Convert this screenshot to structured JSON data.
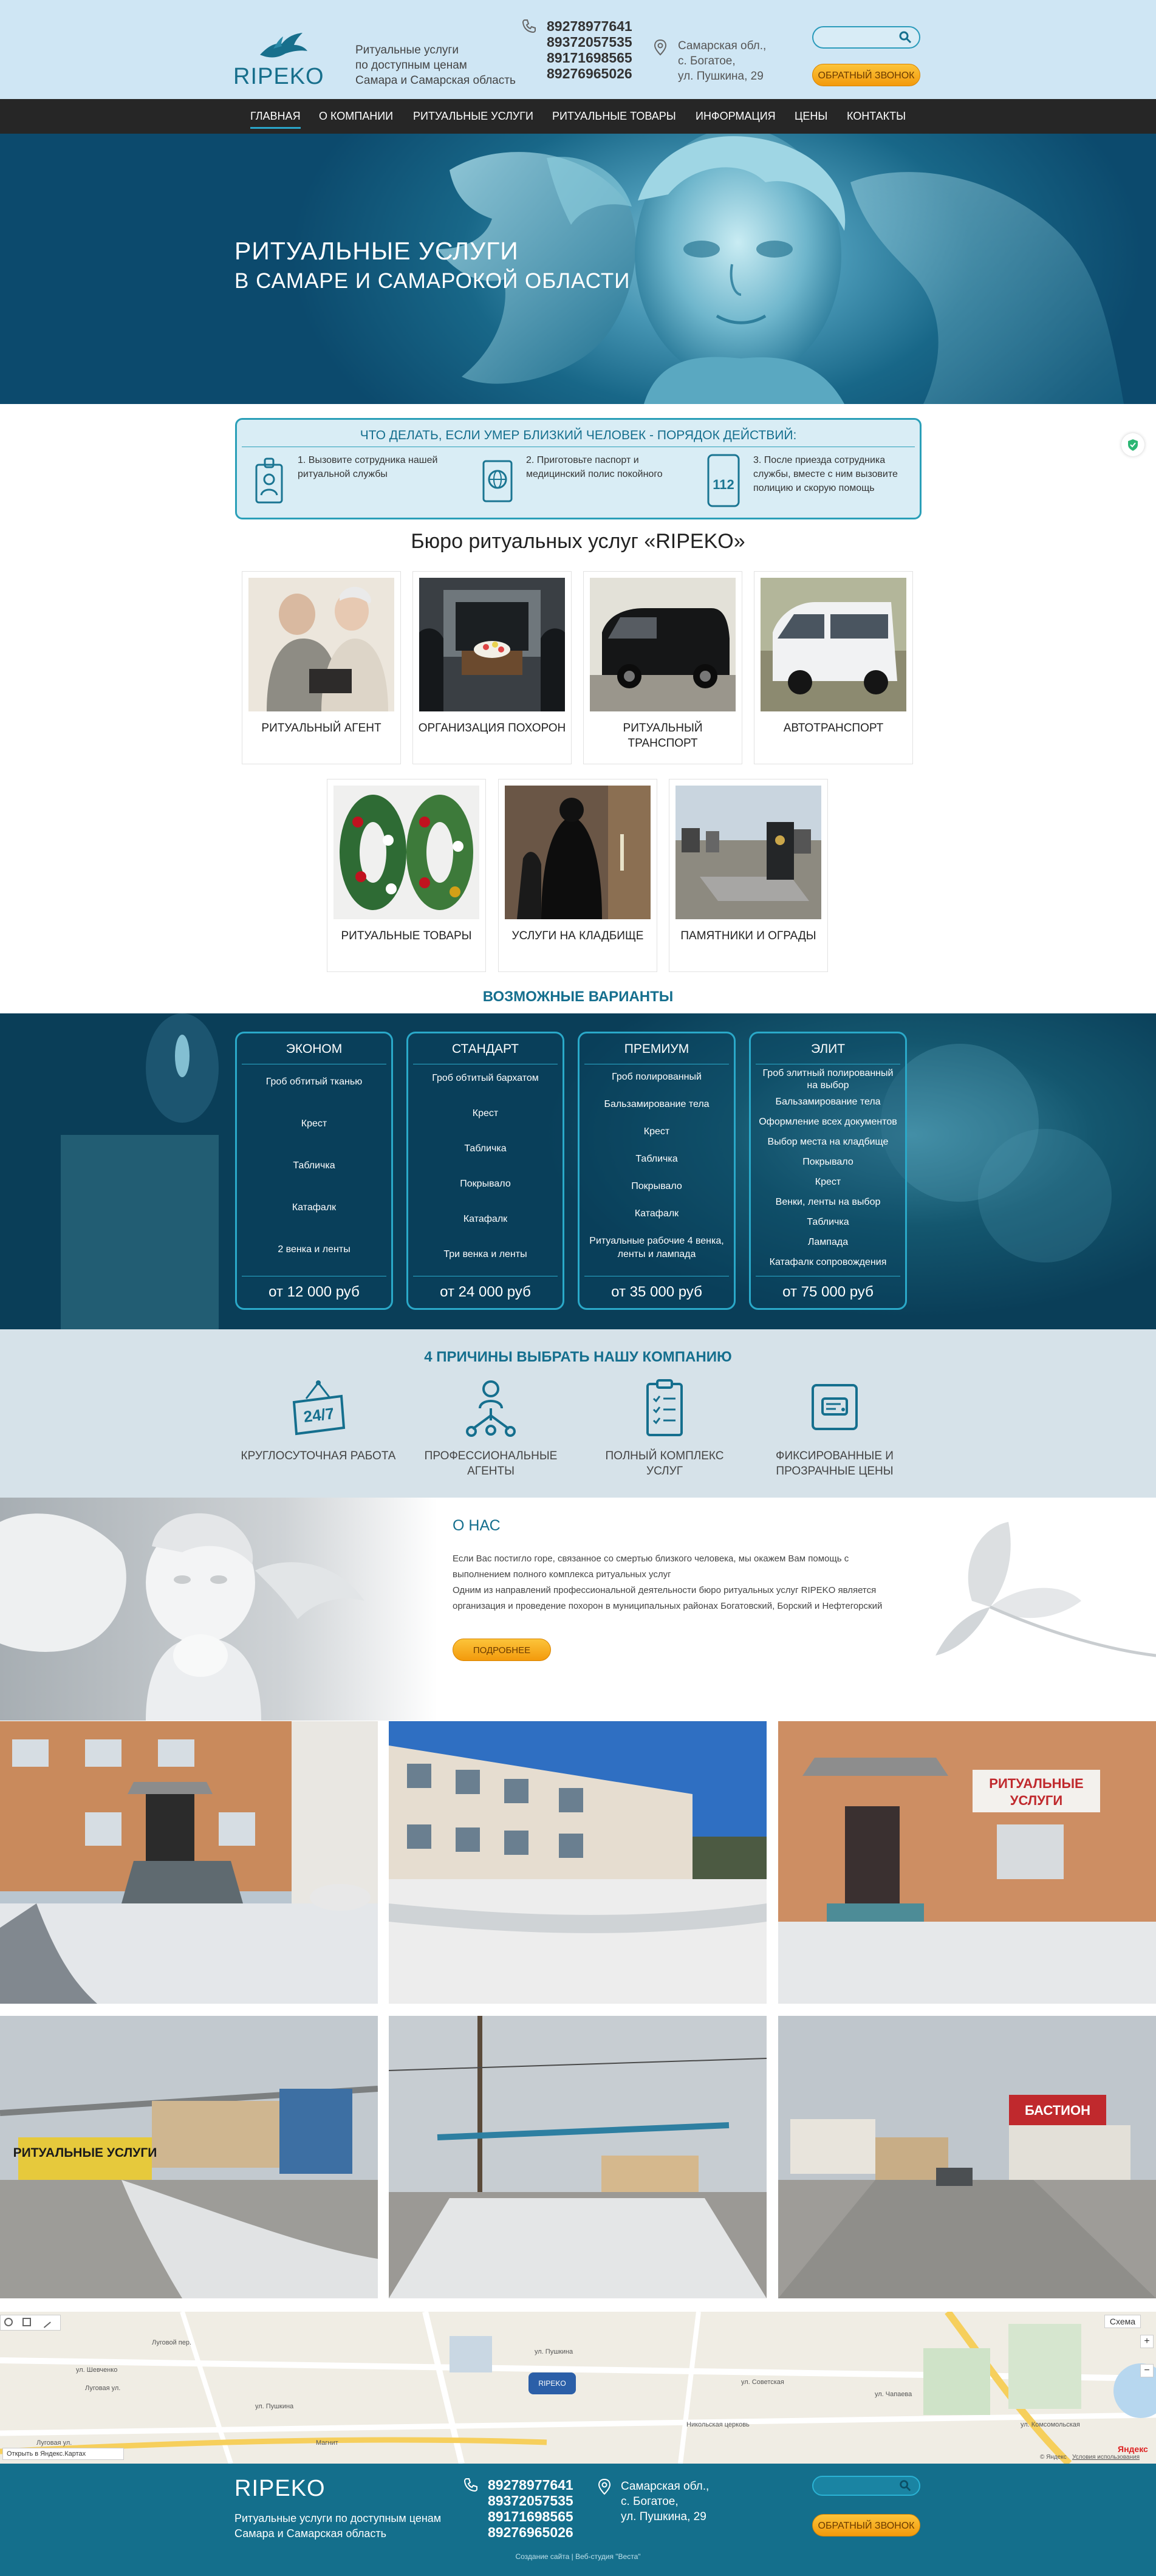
{
  "header": {
    "logo": "RIPEKO",
    "tagline": [
      "Ритуальные услуги",
      "по доступным ценам",
      "Самара и Самарская область"
    ],
    "phones": [
      "89278977641",
      "89372057535",
      "89171698565",
      "89276965026"
    ],
    "address": [
      "Самарская обл.,",
      "с. Богатое,",
      "ул. Пушкина, 29"
    ],
    "search_placeholder": "",
    "callback_label": "ОБРАТНЫЙ ЗВОНОК"
  },
  "nav": {
    "items": [
      "ГЛАВНАЯ",
      "О КОМПАНИИ",
      "РИТУАЛЬНЫЕ УСЛУГИ",
      "РИТУАЛЬНЫЕ ТОВАРЫ",
      "ИНФОРМАЦИЯ",
      "ЦЕНЫ",
      "КОНТАКТЫ"
    ],
    "active": "ГЛАВНАЯ"
  },
  "hero": {
    "line1": "РИТУАЛЬНЫЕ УСЛУГИ",
    "line2": "В САМАРЕ И САМАРОКОЙ ОБЛАСТИ"
  },
  "steps": {
    "title": "ЧТО ДЕЛАТЬ, ЕСЛИ УМЕР БЛИЗКИЙ ЧЕЛОВЕК - ПОРЯДОК ДЕЙСТВИЙ:",
    "items": [
      [
        "1. Вызовите сотрудника нашей",
        "ритуальной службы"
      ],
      [
        "2. Приготовьте паспорт и",
        "медицинский полис покойного"
      ],
      [
        "3. После приезда сотрудника",
        "службы, вместе с ним вызовите",
        "полицию и скорую помощь"
      ]
    ],
    "icon_labels": [
      "112"
    ]
  },
  "services": {
    "title": "Бюро ритуальных услуг «RIPEKO»",
    "row1": [
      [
        "РИТУАЛЬНЫЙ АГЕНТ"
      ],
      [
        "ОРГАНИЗАЦИЯ ПОХОРОН"
      ],
      [
        "РИТУАЛЬНЫЙ",
        "ТРАНСПОРТ"
      ],
      [
        "АВТОТРАНСПОРТ"
      ]
    ],
    "row2": [
      [
        "РИТУАЛЬНЫЕ ТОВАРЫ"
      ],
      [
        "УСЛУГИ НА КЛАДБИЩЕ"
      ],
      [
        "ПАМЯТНИКИ И ОГРАДЫ"
      ]
    ]
  },
  "variants": {
    "title": "ВОЗМОЖНЫЕ ВАРИАНТЫ",
    "plans": [
      {
        "name": "ЭКОНОМ",
        "items": [
          "Гроб обтитый тканью",
          "Крест",
          "Табличка",
          "Катафалк",
          "2 венка и ленты"
        ],
        "price": "от 12 000 руб"
      },
      {
        "name": "СТАНДАРТ",
        "items": [
          "Гроб обтитый бархатом",
          "Крест",
          "Табличка",
          "Покрывало",
          "Катафалк",
          "Три венка и ленты"
        ],
        "price": "от 24 000 руб"
      },
      {
        "name": "ПРЕМИУМ",
        "items": [
          "Гроб полированный",
          "Бальзамирование тела",
          "Крест",
          "Табличка",
          "Покрывало",
          "Катафалк",
          "Ритуальные рабочие 4 венка,",
          "ленты и лампада"
        ],
        "price": "от 35 000 руб"
      },
      {
        "name": "ЭЛИТ",
        "items": [
          "Гроб элитный полированный",
          "на выбор",
          "Бальзамирование тела",
          "Оформление всех документов",
          "Выбор места на кладбище",
          "Покрывало",
          "Крест",
          "Венки, ленты на выбор",
          "Табличка",
          "Лампада",
          "Катафалк сопровождения"
        ],
        "price": "от 75 000 руб"
      }
    ]
  },
  "reasons": {
    "title": "4 ПРИЧИНЫ ВЫБРАТЬ НАШУ КОМПАНИЮ",
    "items": [
      [
        "КРУГЛОСУТОЧНАЯ РАБОТА"
      ],
      [
        "ПРОФЕССИОНАЛЬНЫЕ",
        "АГЕНТЫ"
      ],
      [
        "ПОЛНЫЙ КОМПЛЕКС УСЛУГ"
      ],
      [
        "ФИКСИРОВАННЫЕ И",
        "ПРОЗРАЧНЫЕ ЦЕНЫ"
      ]
    ],
    "badge": "24/7"
  },
  "about": {
    "title": "О НАС",
    "lines": [
      "Если Вас постигло горе, связанное со смертью близкого человека, мы окажем Вам помощь с",
      "выполнением полного комплекса ритуальных услуг",
      "Одним из направлений профессиональной деятельности бюро ритуальных услуг RIPEKO является",
      "организация и проведение похорон в муниципальных районах Богатовский, Борский и Нефтегорский"
    ],
    "more_label": "ПОДРОБНЕЕ"
  },
  "gallery": {
    "signs": [
      "РИТУАЛЬНЫЕ",
      "УСЛУГИ",
      "РИТУАЛЬНЫЕ УСЛУГИ",
      "БАСТИОН"
    ]
  },
  "map": {
    "marker": "RIPEKO",
    "type_label": "Схема",
    "open_label": "Открыть в Яндекс.Картах",
    "brand": "Яндекс",
    "terms": "Условия использования",
    "copyright": "© Яндекс",
    "streets": [
      "ул. Шевченко",
      "Луговая ул.",
      "Луговой пер.",
      "ул. Пушкина",
      "Луговая ул.",
      "ул. Пушкина",
      "Никольская церковь",
      "Магнит",
      "ул. Чапаева",
      "ул. Советская",
      "ул. Комсомольская"
    ]
  },
  "footer": {
    "logo": "RIPEKO",
    "tagline": [
      "Ритуальные услуги по доступным ценам",
      "Самара и Самарская область"
    ],
    "phones": [
      "89278977641",
      "89372057535",
      "89171698565",
      "89276965026"
    ],
    "address": [
      "Самарская обл.,",
      "с. Богатое,",
      "ул. Пушкина, 29"
    ],
    "callback_label": "ОБРАТНЫЙ ЗВОНОК",
    "credit": "Создание сайта | Веб-студия \"Веста\""
  },
  "colors": {
    "accent": "#2a9fb8",
    "dark_teal": "#146f8c",
    "orange": "#f5a11a",
    "nav": "#262626"
  }
}
